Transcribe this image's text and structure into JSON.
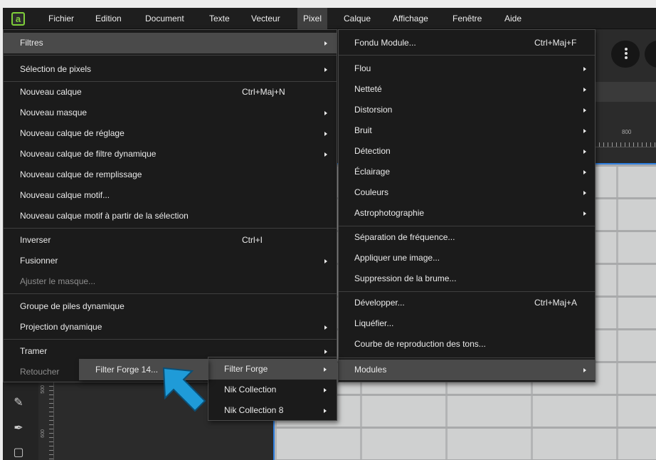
{
  "menubar": {
    "logo": "a",
    "items": [
      "Fichier",
      "Edition",
      "Document",
      "Texte",
      "Vecteur",
      "Pixel",
      "Calque",
      "Affichage",
      "Fenêtre",
      "Aide"
    ]
  },
  "ruler": {
    "top_label": "800",
    "left_label_1": "500",
    "left_label_2": "600"
  },
  "pixel_menu": {
    "items": [
      {
        "label": "Filtres",
        "shortcut": "",
        "submenu": true
      },
      {
        "label": "Sélection de pixels",
        "shortcut": "",
        "submenu": true
      },
      {
        "label": "Nouveau calque",
        "shortcut": "Ctrl+Maj+N",
        "submenu": false
      },
      {
        "label": "Nouveau masque",
        "shortcut": "",
        "submenu": true
      },
      {
        "label": "Nouveau calque de réglage",
        "shortcut": "",
        "submenu": true
      },
      {
        "label": "Nouveau calque de filtre dynamique",
        "shortcut": "",
        "submenu": true
      },
      {
        "label": "Nouveau calque de remplissage",
        "shortcut": "",
        "submenu": false
      },
      {
        "label": "Nouveau calque motif...",
        "shortcut": "",
        "submenu": false
      },
      {
        "label": "Nouveau calque motif à partir de la sélection",
        "shortcut": "",
        "submenu": false
      },
      {
        "label": "Inverser",
        "shortcut": "Ctrl+I",
        "submenu": false
      },
      {
        "label": "Fusionner",
        "shortcut": "",
        "submenu": true
      },
      {
        "label": "Ajuster le masque...",
        "shortcut": "",
        "submenu": false
      },
      {
        "label": "Groupe de piles dynamique",
        "shortcut": "",
        "submenu": false
      },
      {
        "label": "Projection dynamique",
        "shortcut": "",
        "submenu": true
      },
      {
        "label": "Tramer",
        "shortcut": "",
        "submenu": true
      },
      {
        "label": "Retoucher",
        "shortcut": "",
        "submenu": false
      }
    ]
  },
  "filtres_menu": {
    "items": [
      {
        "label": "Fondu Module...",
        "shortcut": "Ctrl+Maj+F",
        "submenu": false
      },
      {
        "label": "Flou",
        "shortcut": "",
        "submenu": true
      },
      {
        "label": "Netteté",
        "shortcut": "",
        "submenu": true
      },
      {
        "label": "Distorsion",
        "shortcut": "",
        "submenu": true
      },
      {
        "label": "Bruit",
        "shortcut": "",
        "submenu": true
      },
      {
        "label": "Détection",
        "shortcut": "",
        "submenu": true
      },
      {
        "label": "Éclairage",
        "shortcut": "",
        "submenu": true
      },
      {
        "label": "Couleurs",
        "shortcut": "",
        "submenu": true
      },
      {
        "label": "Astrophotographie",
        "shortcut": "",
        "submenu": true
      },
      {
        "label": "Séparation de fréquence...",
        "shortcut": "",
        "submenu": false
      },
      {
        "label": "Appliquer une image...",
        "shortcut": "",
        "submenu": false
      },
      {
        "label": "Suppression de la brume...",
        "shortcut": "",
        "submenu": false
      },
      {
        "label": "Développer...",
        "shortcut": "Ctrl+Maj+A",
        "submenu": false
      },
      {
        "label": "Liquéfier...",
        "shortcut": "",
        "submenu": false
      },
      {
        "label": "Courbe de reproduction des tons...",
        "shortcut": "",
        "submenu": false
      },
      {
        "label": "Modules",
        "shortcut": "",
        "submenu": true
      }
    ]
  },
  "modules_menu": {
    "items": [
      {
        "label": "Filter Forge",
        "submenu": true
      },
      {
        "label": "Nik Collection",
        "submenu": true
      },
      {
        "label": "Nik Collection 8",
        "submenu": true
      }
    ]
  },
  "filterforge_menu": {
    "items": [
      {
        "label": "Filter Forge 14..."
      }
    ]
  },
  "colors": {
    "accent_arrow": "#1f9bd8",
    "menu_bg": "#1b1b1b",
    "highlight": "#4a4a4a"
  }
}
